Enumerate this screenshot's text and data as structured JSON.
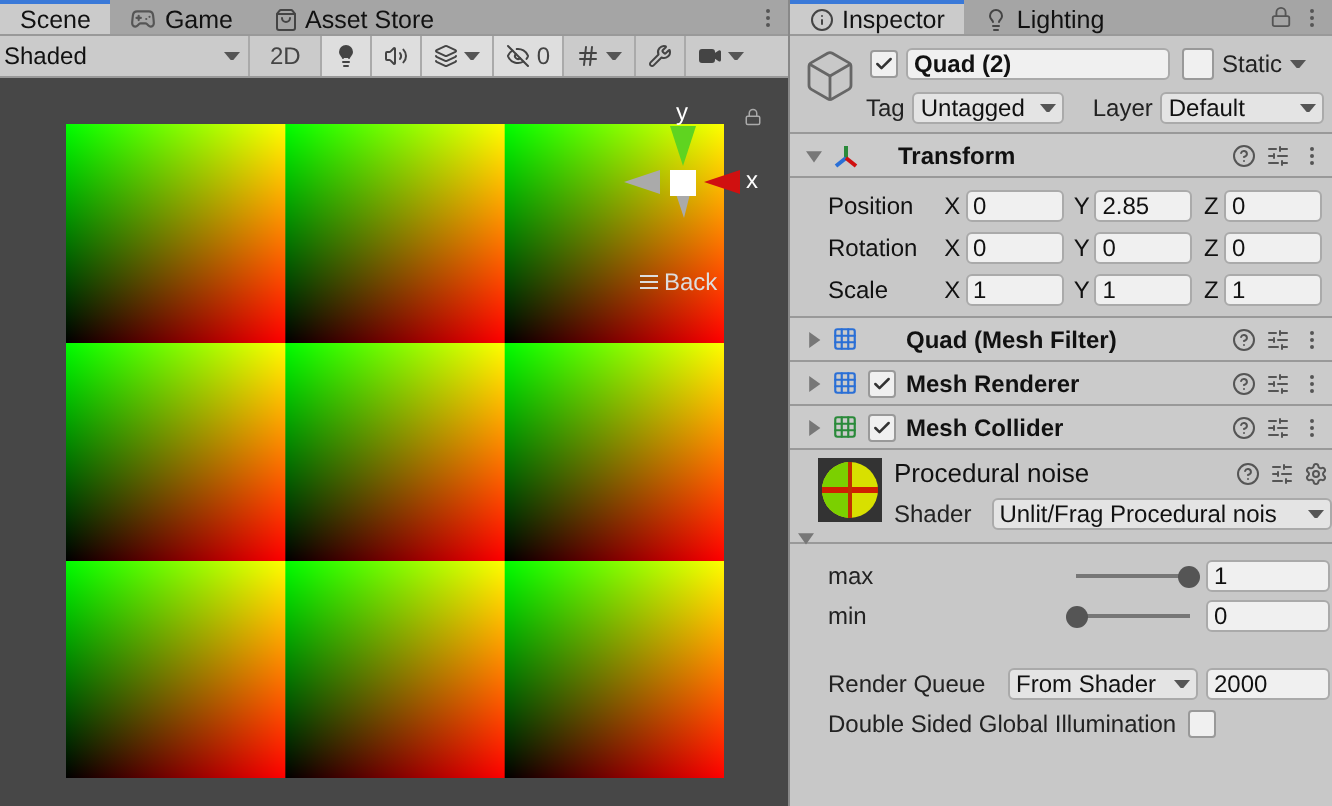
{
  "scene_view": {
    "tabs": [
      {
        "label": "Scene",
        "selected": true,
        "kind": "scene"
      },
      {
        "label": "Game",
        "selected": false,
        "kind": "game"
      },
      {
        "label": "Asset Store",
        "selected": false,
        "kind": "store"
      }
    ],
    "toolbar": {
      "draw_mode": "Shaded",
      "mode_2d": "2D",
      "hidden_count": "0"
    },
    "gizmo": {
      "y_label": "y",
      "x_label": "x",
      "projection": "Back"
    }
  },
  "inspector": {
    "tabs": [
      {
        "label": "Inspector",
        "selected": true,
        "kind": "info"
      },
      {
        "label": "Lighting",
        "selected": false,
        "kind": "bulb"
      }
    ],
    "object": {
      "active": true,
      "name": "Quad (2)",
      "static_label": "Static",
      "static": false,
      "tag_label": "Tag",
      "tag": "Untagged",
      "layer_label": "Layer",
      "layer": "Default"
    },
    "transform": {
      "title": "Transform",
      "expanded": true,
      "rows": [
        {
          "label": "Position",
          "fields": [
            {
              "axis": "X",
              "value": "0"
            },
            {
              "axis": "Y",
              "value": "2.85"
            },
            {
              "axis": "Z",
              "value": "0"
            }
          ]
        },
        {
          "label": "Rotation",
          "fields": [
            {
              "axis": "X",
              "value": "0"
            },
            {
              "axis": "Y",
              "value": "0"
            },
            {
              "axis": "Z",
              "value": "0"
            }
          ]
        },
        {
          "label": "Scale",
          "fields": [
            {
              "axis": "X",
              "value": "1"
            },
            {
              "axis": "Y",
              "value": "1"
            },
            {
              "axis": "Z",
              "value": "1"
            }
          ]
        }
      ]
    },
    "components": [
      {
        "title": "Quad (Mesh Filter)",
        "kind": "filter",
        "expanded": false
      },
      {
        "title": "Mesh Renderer",
        "kind": "renderer",
        "expanded": false,
        "enabled": true
      },
      {
        "title": "Mesh Collider",
        "kind": "collider",
        "expanded": false,
        "enabled": true
      }
    ],
    "material": {
      "name": "Procedural noise",
      "shader_label": "Shader",
      "shader": "Unlit/Frag Procedural nois",
      "expanded": true,
      "properties": [
        {
          "kind": "slider",
          "label": "max",
          "level": 1,
          "value": "1"
        },
        {
          "kind": "slider",
          "label": "min",
          "level": 0,
          "value": "0"
        }
      ],
      "render_queue": {
        "label": "Render Queue",
        "mode": "From Shader",
        "value": "2000"
      },
      "double_sided": {
        "label": "Double Sided Global Illumination",
        "checked": false
      }
    }
  }
}
